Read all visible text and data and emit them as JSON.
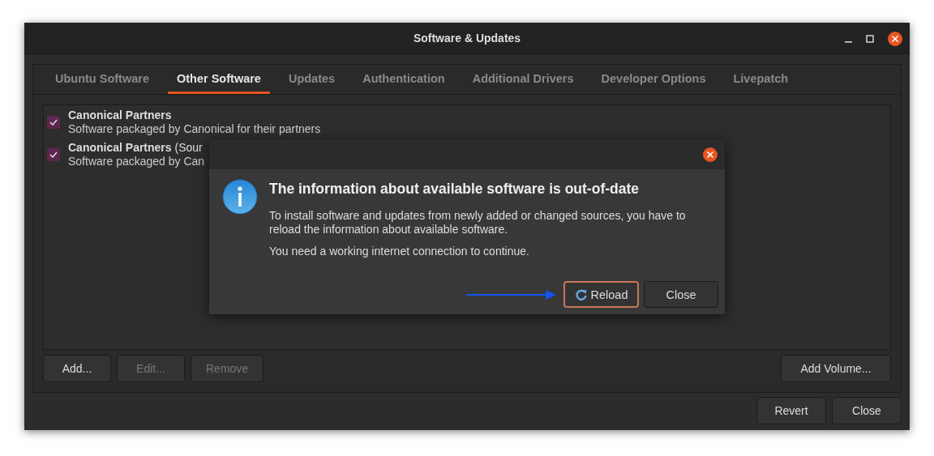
{
  "window": {
    "title": "Software & Updates"
  },
  "tabs": [
    {
      "label": "Ubuntu Software",
      "selected": false
    },
    {
      "label": "Other Software",
      "selected": true
    },
    {
      "label": "Updates",
      "selected": false
    },
    {
      "label": "Authentication",
      "selected": false
    },
    {
      "label": "Additional Drivers",
      "selected": false
    },
    {
      "label": "Developer Options",
      "selected": false
    },
    {
      "label": "Livepatch",
      "selected": false
    }
  ],
  "sources": [
    {
      "name": "**Canonical Partners**",
      "description": "Software packaged by Canonical for their partners",
      "checked": true
    },
    {
      "name": "**Canonical Partners** (Sour",
      "description": "Software packaged by Can",
      "checked": true
    }
  ],
  "source_buttons": [
    {
      "label": "Add...",
      "disabled": false
    },
    {
      "label": "Edit...",
      "disabled": true
    },
    {
      "label": "Remove",
      "disabled": true
    }
  ],
  "volume_button": {
    "label": "Add Volume...",
    "disabled": false
  },
  "footer_buttons": [
    {
      "label": "Revert"
    },
    {
      "label": "Close"
    }
  ],
  "dialog": {
    "title": "The information about available software is out-of-date",
    "paragraphs": [
      "To install software and updates from newly added or changed sources, you have to reload the information about available software.",
      "You need a working internet connection to continue."
    ],
    "buttons": [
      {
        "label": "Reload",
        "kind": "reload",
        "focused": true
      },
      {
        "label": "Close",
        "kind": "plain",
        "focused": false
      }
    ]
  }
}
